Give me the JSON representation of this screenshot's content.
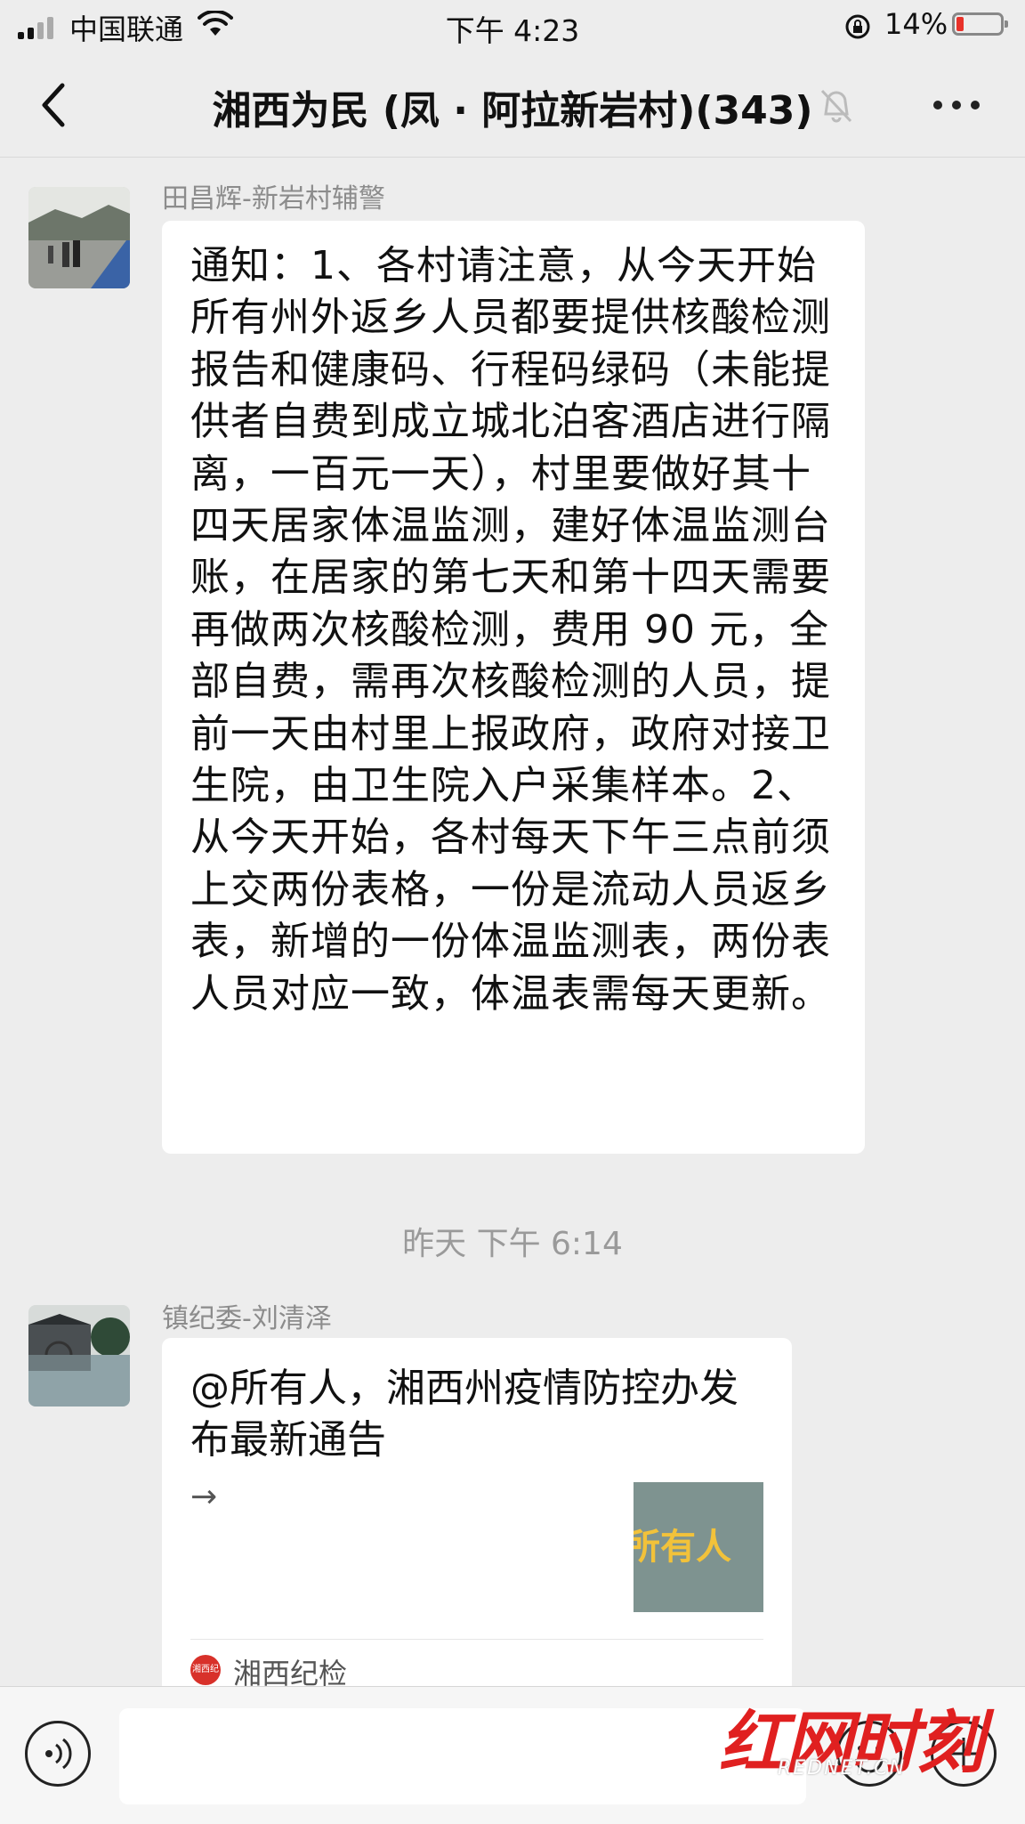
{
  "status_bar": {
    "carrier": "中国联通",
    "time": "下午 4:23",
    "battery_percent": "14%"
  },
  "nav": {
    "title": "湘西为民 (凤 · 阿拉新岩村)(343)",
    "muted": true
  },
  "messages": [
    {
      "sender": "田昌辉-新岩村辅警",
      "text": "通知：1、各村请注意，从今天开始所有州外返乡人员都要提供核酸检测报告和健康码、行程码绿码（未能提供者自费到成立城北泊客酒店进行隔离，一百元一天），村里要做好其十四天居家体温监测，建好体温监测台账，在居家的第七天和第十四天需要再做两次核酸检测，费用 90 元，全部自费，需再次核酸检测的人员，提前一天由村里上报政府，政府对接卫生院，由卫生院入户采集样本。2、从今天开始，各村每天下午三点前须上交两份表格，一份是流动人员返乡表，新增的一份体温监测表，两份表人员对应一致，体温表需每天更新。"
    },
    {
      "sender": "镇纪委-刘清泽",
      "card": {
        "title": "@所有人，湘西州疫情防控办发布最新通告",
        "arrow": "→",
        "thumb_text": "所有人",
        "source_badge": "湘西纪检",
        "source": "湘西纪检"
      }
    }
  ],
  "timestamp": "昨天 下午 6:14",
  "watermark": {
    "text": "红网时刻",
    "sub": "REDNET.CN"
  },
  "colors": {
    "background": "#ededed",
    "bubble": "#ffffff",
    "battery_low": "#e8322a",
    "watermark_red": "#e02020"
  },
  "icons": [
    "back-arrow-icon",
    "mute-bell-icon",
    "more-dots-icon",
    "voice-icon",
    "emoji-icon",
    "plus-icon",
    "wifi-icon",
    "signal-icon",
    "rotation-lock-icon",
    "battery-icon"
  ]
}
